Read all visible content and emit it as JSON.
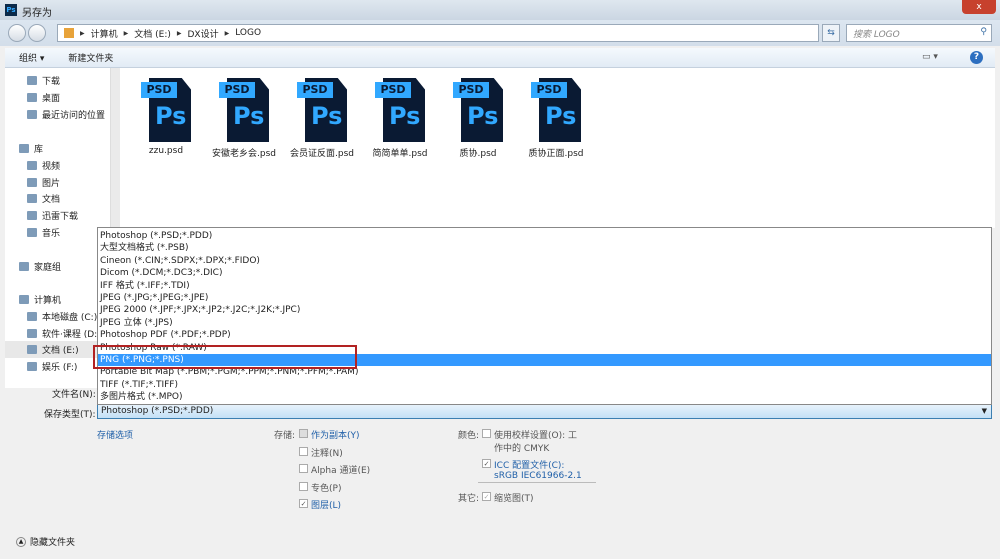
{
  "window": {
    "title": "另存为",
    "close": "x",
    "app_icon": "Ps"
  },
  "address": {
    "crumbs": [
      "计算机",
      "文档 (E:)",
      "DX设计",
      "LOGO"
    ],
    "search_placeholder": "搜索 LOGO"
  },
  "toolbar": {
    "organize": "组织 ▾",
    "new_folder": "新建文件夹",
    "help": "?"
  },
  "sidebar": {
    "items": [
      "下载",
      "桌面",
      "最近访问的位置",
      "库",
      "视频",
      "图片",
      "文档",
      "迅雷下载",
      "音乐",
      "家庭组",
      "计算机",
      "本地磁盘 (C:)",
      "软件·课程 (D:)",
      "文档 (E:)",
      "娱乐 (F:)"
    ]
  },
  "files": [
    {
      "name": "zzu.psd"
    },
    {
      "name": "安徽老乡会.psd"
    },
    {
      "name": "会员证反面.psd"
    },
    {
      "name": "简简单单.psd"
    },
    {
      "name": "质协.psd"
    },
    {
      "name": "质协正面.psd"
    }
  ],
  "file_icon": {
    "tag": "PSD",
    "glyph": "Ps"
  },
  "dropdown": {
    "selected_index": 10,
    "options": [
      "Photoshop (*.PSD;*.PDD)",
      "大型文档格式 (*.PSB)",
      "Cineon (*.CIN;*.SDPX;*.DPX;*.FIDO)",
      "Dicom (*.DCM;*.DC3;*.DIC)",
      "IFF 格式 (*.IFF;*.TDI)",
      "JPEG (*.JPG;*.JPEG;*.JPE)",
      "JPEG 2000 (*.JPF;*.JPX;*.JP2;*.J2C;*.J2K;*.JPC)",
      "JPEG 立体 (*.JPS)",
      "Photoshop PDF (*.PDF;*.PDP)",
      "Photoshop Raw (*.RAW)",
      "PNG (*.PNG;*.PNS)",
      "Portable Bit Map (*.PBM;*.PGM;*.PPM;*.PNM;*.PFM;*.PAM)",
      "TIFF (*.TIF;*.TIFF)",
      "多图片格式 (*.MPO)"
    ]
  },
  "form": {
    "filename_label": "文件名(N):",
    "type_label": "保存类型(T):",
    "type_value": "Photoshop (*.PSD;*.PDD)"
  },
  "save_options": {
    "link": "存储选项",
    "storage_label": "存储:",
    "as_copy": "作为副本(Y)",
    "notes": "注释(N)",
    "alpha": "Alpha 通道(E)",
    "spot": "专色(P)",
    "layers": "图层(L)",
    "color_label": "颜色:",
    "proof": "使用校样设置(O): 工作中的 CMYK",
    "icc": "ICC 配置文件(C): sRGB IEC61966-2.1",
    "other_label": "其它:",
    "thumb": "缩览图(T)"
  },
  "footer": {
    "hide_folders": "隐藏文件夹"
  },
  "colors": {
    "accent": "#3399ff",
    "highlight_box": "#b22222"
  }
}
